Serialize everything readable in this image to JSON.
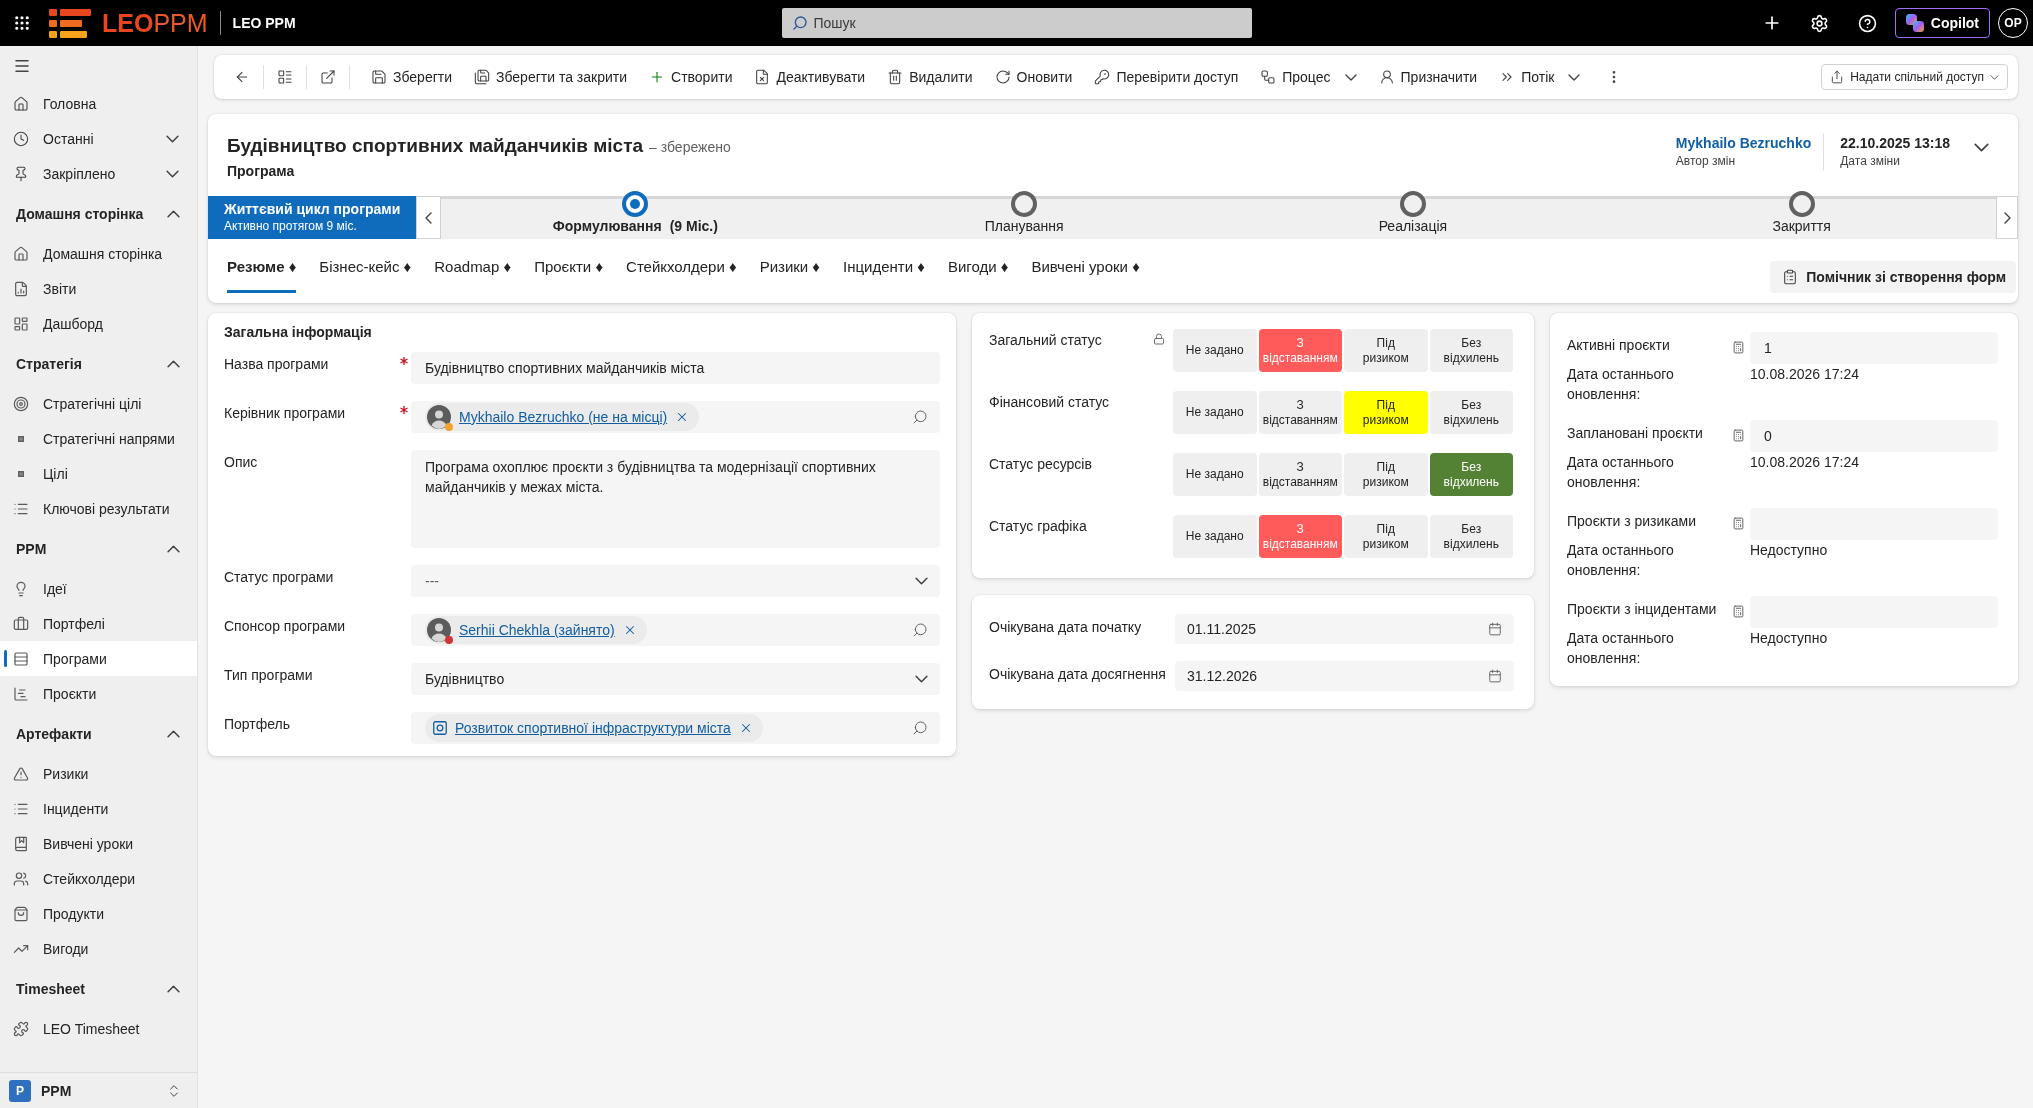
{
  "top_bar": {
    "logo": {
      "primary": "LEO",
      "secondary": "PPM"
    },
    "app_name": "LEO PPM",
    "search": {
      "placeholder": "Пошук"
    },
    "copilot": "Copilot",
    "user_initials": "OP"
  },
  "sidebar": {
    "pinned": [
      {
        "label": "Головна",
        "kind": "link",
        "selected": false
      },
      {
        "label": "Останні",
        "kind": "flyout",
        "expanded": false,
        "selected": false
      },
      {
        "label": "Закріплено",
        "kind": "flyout",
        "expanded": false,
        "selected": false
      }
    ],
    "groups": [
      {
        "title": "Домашня сторінка",
        "expanded": true,
        "items": [
          {
            "label": "Домашня сторінка",
            "selected": false
          },
          {
            "label": "Звіти",
            "selected": false
          },
          {
            "label": "Дашборд",
            "selected": false
          }
        ]
      },
      {
        "title": "Стратегія",
        "expanded": true,
        "items": [
          {
            "label": "Стратегічні цілі",
            "selected": false
          },
          {
            "label": "Стратегічні напрями",
            "selected": false
          },
          {
            "label": "Цілі",
            "selected": false
          },
          {
            "label": "Ключові результати",
            "selected": false
          }
        ]
      },
      {
        "title": "PPM",
        "expanded": true,
        "items": [
          {
            "label": "Ідеї",
            "selected": false
          },
          {
            "label": "Портфелі",
            "selected": false
          },
          {
            "label": "Програми",
            "selected": true
          },
          {
            "label": "Проєкти",
            "selected": false
          }
        ]
      },
      {
        "title": "Артефакти",
        "expanded": true,
        "items": [
          {
            "label": "Ризики",
            "selected": false
          },
          {
            "label": "Інциденти",
            "selected": false
          },
          {
            "label": "Вивчені уроки",
            "selected": false
          },
          {
            "label": "Стейкхолдери",
            "selected": false
          },
          {
            "label": "Продукти",
            "selected": false
          },
          {
            "label": "Вигоди",
            "selected": false
          }
        ]
      },
      {
        "title": "Timesheet",
        "expanded": true,
        "items": [
          {
            "label": "LEO Timesheet",
            "selected": false
          }
        ]
      }
    ],
    "area": {
      "initial": "P",
      "label": "PPM"
    }
  },
  "command_bar": {
    "commands": [
      {
        "label": "Зберегти",
        "has_menu": false
      },
      {
        "label": "Зберегти та закрити",
        "has_menu": false
      },
      {
        "label": "Створити",
        "has_menu": false
      },
      {
        "label": "Деактивувати",
        "has_menu": false
      },
      {
        "label": "Видалити",
        "has_menu": false
      },
      {
        "label": "Оновити",
        "has_menu": false
      },
      {
        "label": "Перевірити доступ",
        "has_menu": false
      },
      {
        "label": "Процес",
        "has_menu": true
      },
      {
        "label": "Призначити",
        "has_menu": false
      },
      {
        "label": "Потік",
        "has_menu": true
      }
    ],
    "share": "Надати спільний доступ"
  },
  "record": {
    "title": "Будівництво спортивних майданчиків міста",
    "save_state": "– збережено",
    "entity": "Програма",
    "owner": {
      "value": "Mykhailo Bezruchko",
      "label": "Автор змін"
    },
    "modified": {
      "value": "22.10.2025 13:18",
      "label": "Дата зміни"
    }
  },
  "process": {
    "name": "Життєвий цикл програми",
    "duration": "Активно протягом 9 міс.",
    "stages": [
      {
        "label": "Формулювання",
        "duration": "(9 Міс.)",
        "selected": true
      },
      {
        "label": "Планування",
        "selected": false
      },
      {
        "label": "Реалізація",
        "selected": false
      },
      {
        "label": "Закриття",
        "selected": false
      }
    ]
  },
  "tabs": [
    {
      "label": "Резюме ♦",
      "selected": true
    },
    {
      "label": "Бізнес-кейс ♦",
      "selected": false
    },
    {
      "label": "Roadmap ♦",
      "selected": false
    },
    {
      "label": "Проєкти ♦",
      "selected": false
    },
    {
      "label": "Стейкхолдери ♦",
      "selected": false
    },
    {
      "label": "Ризики ♦",
      "selected": false
    },
    {
      "label": "Інциденти ♦",
      "selected": false
    },
    {
      "label": "Вигоди ♦",
      "selected": false
    },
    {
      "label": "Вивчені уроки ♦",
      "selected": false
    }
  ],
  "form_helper": "Помічник зі створення форм",
  "general": {
    "title": "Загальна інформація",
    "fields": [
      {
        "label": "Назва програми",
        "required": true,
        "kind": "text",
        "value": "Будівництво спортивних майданчиків міста"
      },
      {
        "label": "Керівник програми",
        "required": true,
        "kind": "person",
        "value": "Mykhailo Bezruchko (не на місці)",
        "color": "#f7a12d"
      },
      {
        "label": "Опис",
        "required": false,
        "kind": "textarea",
        "value": "Програма охоплює проєкти з будівництва та модернізації спортивних майданчиків у межах міста."
      },
      {
        "label": "Статус програми",
        "required": false,
        "kind": "select",
        "placeholder": "---"
      },
      {
        "label": "Спонсор програми",
        "required": false,
        "kind": "person",
        "value": "Serhii Chekhla (зайнято)",
        "color": "#d13438"
      },
      {
        "label": "Тип програми",
        "required": false,
        "kind": "select",
        "value": "Будівництво"
      },
      {
        "label": "Портфель",
        "required": false,
        "kind": "record",
        "value": "Розвиток спортивної інфраструктури міста"
      }
    ]
  },
  "statuses": [
    {
      "label": "Загальний статус",
      "locked": true,
      "options": [
        {
          "label": "Не задано",
          "selected": false
        },
        {
          "label": "З відставанням",
          "selected": true,
          "color": "#ff5b5b"
        },
        {
          "label": "Під ризиком",
          "selected": false
        },
        {
          "label": "Без відхилень",
          "selected": false
        }
      ]
    },
    {
      "label": "Фінансовий статус",
      "locked": false,
      "options": [
        {
          "label": "Не задано",
          "selected": false
        },
        {
          "label": "З відставанням",
          "selected": false
        },
        {
          "label": "Під ризиком",
          "selected": true,
          "color": "#ffff00"
        },
        {
          "label": "Без відхилень",
          "selected": false
        }
      ]
    },
    {
      "label": "Статус ресурсів",
      "locked": false,
      "options": [
        {
          "label": "Не задано",
          "selected": false
        },
        {
          "label": "З відставанням",
          "selected": false
        },
        {
          "label": "Під ризиком",
          "selected": false
        },
        {
          "label": "Без відхилень",
          "selected": true,
          "color": "#548235"
        }
      ]
    },
    {
      "label": "Статус графіка",
      "locked": false,
      "options": [
        {
          "label": "Не задано",
          "selected": false
        },
        {
          "label": "З відставанням",
          "selected": true,
          "color": "#ff5b5b"
        },
        {
          "label": "Під ризиком",
          "selected": false
        },
        {
          "label": "Без відхилень",
          "selected": false
        }
      ]
    }
  ],
  "dates": [
    {
      "label": "Очікувана дата початку",
      "value": "01.11.2025"
    },
    {
      "label": "Очікувана дата досягнення",
      "value": "31.12.2026"
    }
  ],
  "rollups": [
    {
      "label": "Активні проєкти",
      "value": "1",
      "updated_label": "Дата останнього оновлення:",
      "updated_value": "10.08.2026 17:24"
    },
    {
      "label": "Заплановані проєкти",
      "value": "0",
      "updated_label": "Дата останнього оновлення:",
      "updated_value": "10.08.2026 17:24"
    },
    {
      "label": "Проєкти з ризиками",
      "updated_label": "Дата останнього оновлення:",
      "updated_value": "Недоступно"
    },
    {
      "label": "Проєкти з інцидентами",
      "updated_label": "Дата останнього оновлення:",
      "updated_value": "Недоступно"
    }
  ]
}
